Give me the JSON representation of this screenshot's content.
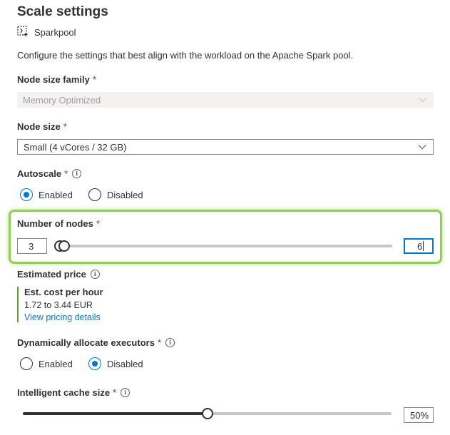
{
  "header": {
    "title": "Scale settings",
    "pool_name": "Sparkpool",
    "description": "Configure the settings that best align with the workload on the Apache Spark pool."
  },
  "node_size_family": {
    "label": "Node size family",
    "required": "*",
    "value": "Memory Optimized"
  },
  "node_size": {
    "label": "Node size",
    "required": "*",
    "value": "Small (4 vCores / 32 GB)"
  },
  "autoscale": {
    "label": "Autoscale",
    "required": "*",
    "options": [
      "Enabled",
      "Disabled"
    ],
    "selected": "Enabled"
  },
  "number_of_nodes": {
    "label": "Number of nodes",
    "required": "*",
    "min_value": "3",
    "max_value": "6"
  },
  "estimated_price": {
    "label": "Estimated price",
    "heading": "Est. cost per hour",
    "range": "1.72 to 3.44 EUR",
    "link": "View pricing details"
  },
  "dynamic_executors": {
    "label": "Dynamically allocate executors",
    "required": "*",
    "options": [
      "Enabled",
      "Disabled"
    ],
    "selected": "Disabled"
  },
  "intelligent_cache": {
    "label": "Intelligent cache size",
    "required": "*",
    "value": "50%",
    "level": 0.5
  },
  "colors": {
    "accent": "#0078d4",
    "highlight": "#8fd14f",
    "required": "#a4262c"
  }
}
